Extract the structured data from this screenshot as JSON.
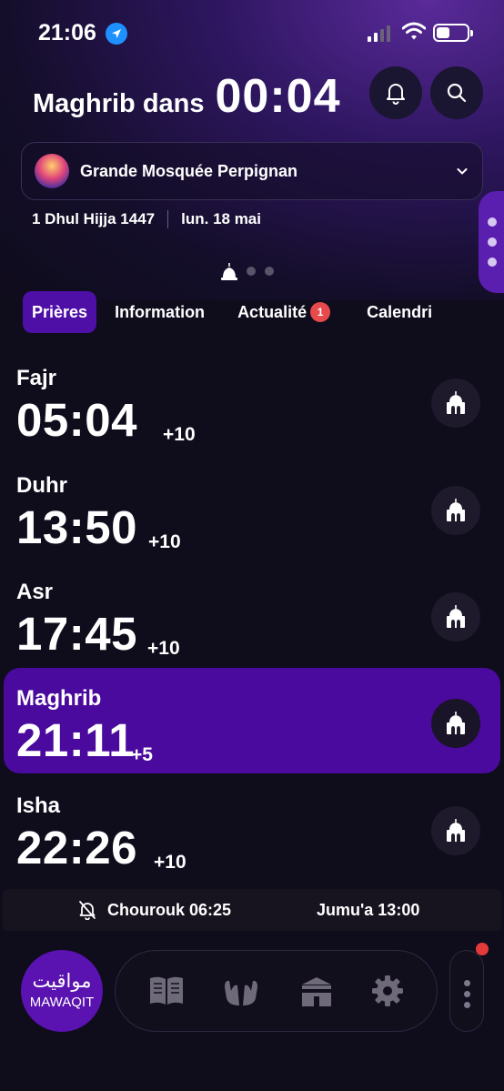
{
  "status_bar": {
    "time": "21:06"
  },
  "header": {
    "countdown_label": "Maghrib dans",
    "countdown_value": "00:04"
  },
  "mosque": {
    "name": "Grande Mosquée Perpignan",
    "hijri_date": "1 Dhul Hijja 1447",
    "gregorian_date": "lun. 18 mai"
  },
  "tabs": [
    {
      "label": "Prières"
    },
    {
      "label": "Information"
    },
    {
      "label": "Actualité",
      "badge": "1"
    },
    {
      "label": "Calendri"
    }
  ],
  "prayers": [
    {
      "name": "Fajr",
      "time": "05:04",
      "offset": "+10"
    },
    {
      "name": "Duhr",
      "time": "13:50",
      "offset": "+10"
    },
    {
      "name": "Asr",
      "time": "17:45",
      "offset": "+10"
    },
    {
      "name": "Maghrib",
      "time": "21:11",
      "offset": "+5"
    },
    {
      "name": "Isha",
      "time": "22:26",
      "offset": "+10"
    }
  ],
  "info_bar": {
    "shuruq": "Chourouk 06:25",
    "jumua": "Jumu'a 13:00"
  },
  "logo": {
    "arabic": "مواقيت",
    "latin": "MAWAQIT"
  },
  "colors": {
    "accent": "#4a0a9e",
    "active_tab": "#4e0fa6",
    "badge": "#e74a4a",
    "background": "#0f0c1c"
  },
  "icons": [
    "location-arrow-icon",
    "bell-icon",
    "search-icon",
    "chevron-down-icon",
    "mosque-icon",
    "bell-off-icon",
    "quran-icon",
    "dua-hands-icon",
    "kaaba-icon",
    "gear-icon"
  ]
}
